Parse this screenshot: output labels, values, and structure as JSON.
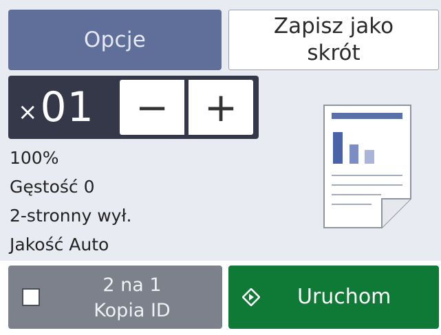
{
  "top_buttons": {
    "options_label": "Opcje",
    "save_shortcut_line1": "Zapisz jako",
    "save_shortcut_line2": "skrót"
  },
  "copies": {
    "multiplier_symbol": "×",
    "count": "01",
    "minus_label": "−",
    "plus_label": "+"
  },
  "settings": [
    "100%",
    "Gęstość 0",
    "2-stronny wył.",
    "Jakość Auto"
  ],
  "bottom": {
    "two_in_one_line1": "2 na 1",
    "two_in_one_line2": "Kopia ID",
    "two_in_one_checked": false,
    "start_label": "Uruchom"
  },
  "icons": {
    "document": "document-preview-icon",
    "start": "start-icon",
    "checkbox": "checkbox-icon"
  },
  "colors": {
    "options_button": "#5f6f99",
    "copies_box": "#343848",
    "start_button": "#0f7a35",
    "two_in_one_button": "#7d818b",
    "background": "#e9ebf2",
    "doc_accent": "#5b6fa8"
  }
}
